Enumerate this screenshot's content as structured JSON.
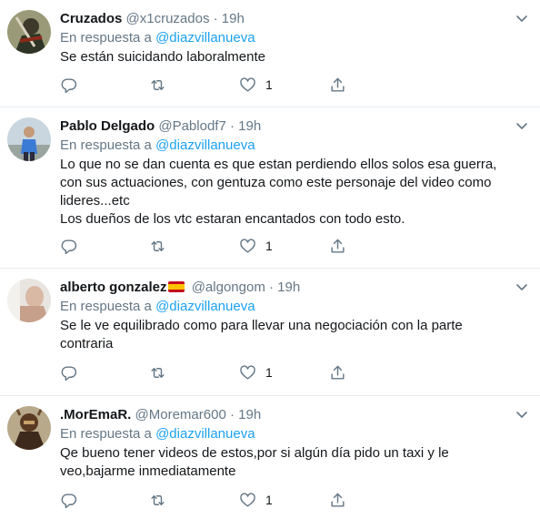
{
  "reply_prefix": "En respuesta a",
  "tweets": [
    {
      "name": "Cruzados",
      "handle": "@x1cruzados",
      "dot": "·",
      "time": "19h",
      "reply_to": "@diazvillanueva",
      "text": "Se están suicidando laboralmente",
      "likes": "1",
      "avatar": "warrior-avatar"
    },
    {
      "name": "Pablo Delgado",
      "handle": "@Pablodf7",
      "dot": "·",
      "time": "19h",
      "reply_to": "@diazvillanueva",
      "text": "Lo que no se dan cuenta es que estan perdiendo ellos solos esa guerra,\ncon sus actuaciones, con gentuza como este personaje del video como\nlideres...etc\nLos dueños de los vtc estaran encantados con todo esto.",
      "likes": "1",
      "avatar": "person-avatar"
    },
    {
      "name": "alberto gonzalez",
      "handle": "@algongom",
      "dot": "·",
      "time": "19h",
      "reply_to": "@diazvillanueva",
      "text": "Se le ve equilibrado como para llevar una negociación con la parte\ncontraria",
      "likes": "1",
      "flag": "spain-flag-icon",
      "avatar": "photo-avatar"
    },
    {
      "name": ".MorEmaR.",
      "handle": "@Moremar600",
      "dot": "·",
      "time": "19h",
      "reply_to": "@diazvillanueva",
      "text": "Qe bueno tener videos de estos,por si algún día pido un taxi y le\nveo,bajarme inmediatamente",
      "likes": "1",
      "avatar": "warrior-avatar"
    }
  ],
  "colors": {
    "text": "#14171a",
    "secondary": "#657786",
    "link": "#1da1f2",
    "divider": "#e6ecf0"
  }
}
